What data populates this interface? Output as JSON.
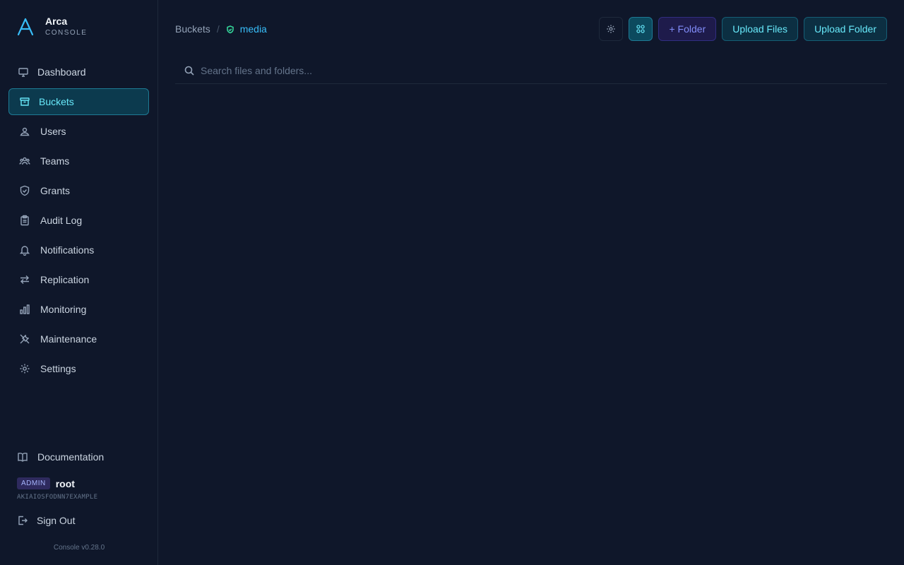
{
  "brand": {
    "name": "Arca",
    "subtitle": "CONSOLE",
    "accent": "#38bdf8"
  },
  "sidebar": {
    "items": [
      {
        "label": "Dashboard",
        "icon": "monitor-icon"
      },
      {
        "label": "Buckets",
        "icon": "archive-box-icon",
        "active": true
      },
      {
        "label": "Users",
        "icon": "user-icon"
      },
      {
        "label": "Teams",
        "icon": "team-icon"
      },
      {
        "label": "Grants",
        "icon": "shield-check-icon"
      },
      {
        "label": "Audit Log",
        "icon": "clipboard-icon"
      },
      {
        "label": "Notifications",
        "icon": "bell-icon"
      },
      {
        "label": "Replication",
        "icon": "arrows-swap-icon"
      },
      {
        "label": "Monitoring",
        "icon": "bar-chart-icon"
      },
      {
        "label": "Maintenance",
        "icon": "tools-icon"
      },
      {
        "label": "Settings",
        "icon": "gear-icon"
      }
    ],
    "documentation": "Documentation",
    "user": {
      "role_badge": "ADMIN",
      "name": "root",
      "access_key": "AKIAIOSFODNN7EXAMPLE"
    },
    "sign_out": "Sign Out",
    "version": "Console v0.28.0"
  },
  "breadcrumb": {
    "parent": "Buckets",
    "separator": "/",
    "current": "media"
  },
  "toolbar": {
    "new_folder": "+ Folder",
    "upload_files": "Upload Files",
    "upload_folder": "Upload Folder"
  },
  "search": {
    "placeholder": "Search files and folders..."
  }
}
